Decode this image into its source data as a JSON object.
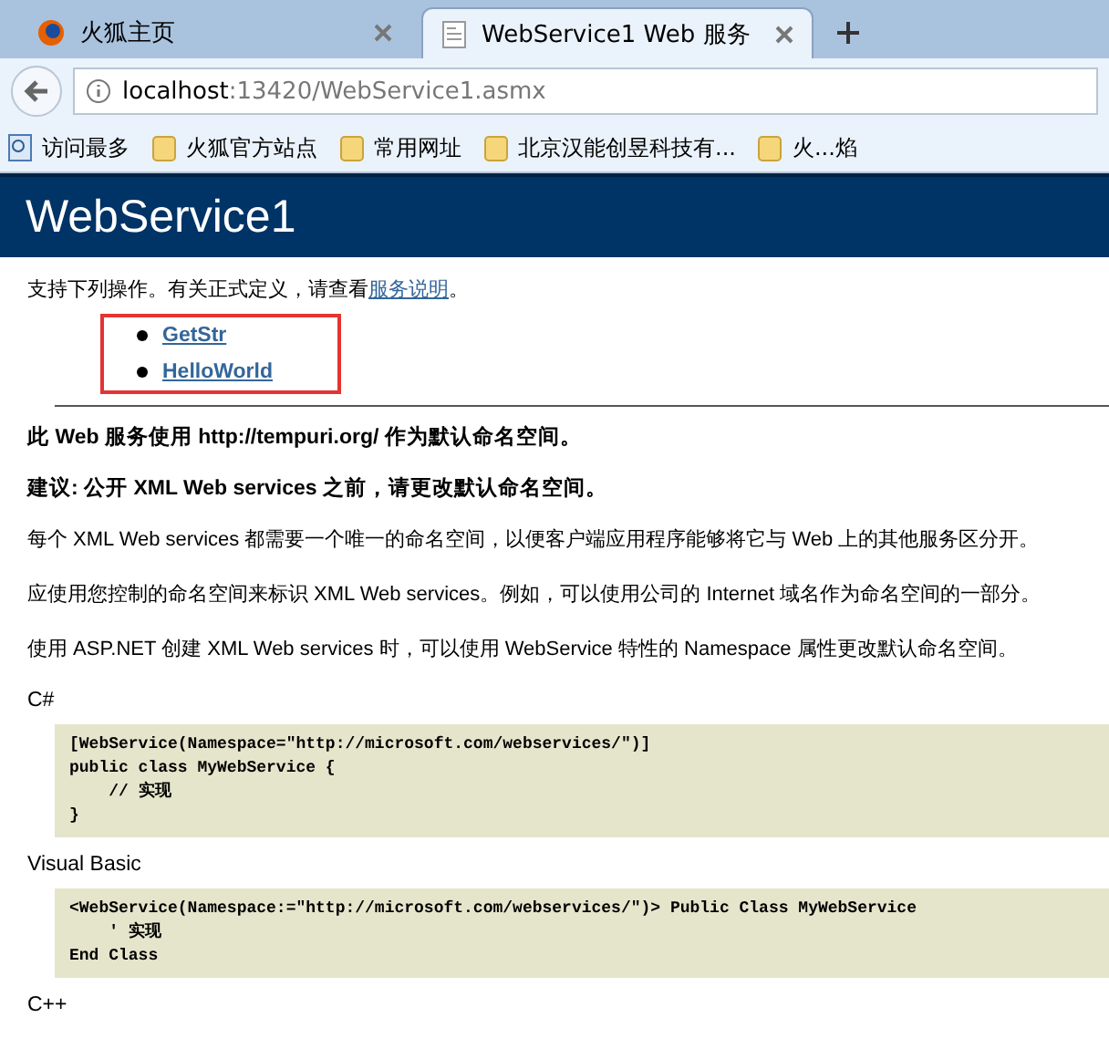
{
  "tabs": [
    {
      "label": "火狐主页",
      "selected": false
    },
    {
      "label": "WebService1 Web 服务",
      "selected": true
    }
  ],
  "address": {
    "host": "localhost",
    "rest": ":13420/WebService1.asmx"
  },
  "bookmarks": [
    {
      "label": "访问最多"
    },
    {
      "label": "火狐官方站点"
    },
    {
      "label": "常用网址"
    },
    {
      "label": "北京汉能创昱科技有..."
    },
    {
      "label": "火...焰"
    }
  ],
  "page": {
    "title": "WebService1",
    "intro": {
      "text": "支持下列操作。有关正式定义，请查看",
      "link": "服务说明",
      "end": "。"
    },
    "operations": [
      "GetStr",
      "HelloWorld"
    ],
    "notes_bold": [
      "此 Web 服务使用 http://tempuri.org/ 作为默认命名空间。",
      "建议: 公开 XML Web services 之前，请更改默认命名空间。"
    ],
    "paragraphs": [
      "每个 XML Web services 都需要一个唯一的命名空间，以便客户端应用程序能够将它与 Web 上的其他服务区分开。",
      "应使用您控制的命名空间来标识 XML Web services。例如，可以使用公司的 Internet 域名作为命名空间的一部分。",
      "使用 ASP.NET 创建 XML Web services 时，可以使用 WebService 特性的 Namespace 属性更改默认命名空间。"
    ],
    "code_samples": [
      {
        "language": "C#",
        "lines": [
          "[WebService(Namespace=\"http://microsoft.com/webservices/\")]",
          "public class MyWebService {",
          "    // 实现",
          "}"
        ]
      },
      {
        "language": "Visual Basic",
        "lines": [
          "<WebService(Namespace:=\"http://microsoft.com/webservices/\")> Public Class MyWebService",
          "    ' 实现",
          "End Class"
        ]
      },
      {
        "language": "C++"
      }
    ]
  }
}
